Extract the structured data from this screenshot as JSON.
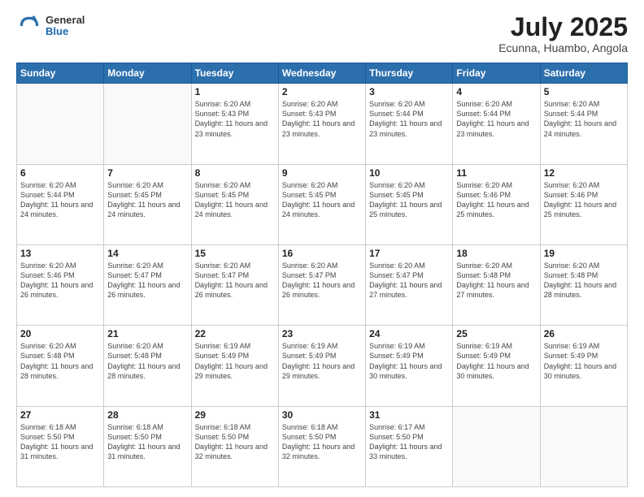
{
  "logo": {
    "general": "General",
    "blue": "Blue"
  },
  "header": {
    "month": "July 2025",
    "location": "Ecunna, Huambo, Angola"
  },
  "days_of_week": [
    "Sunday",
    "Monday",
    "Tuesday",
    "Wednesday",
    "Thursday",
    "Friday",
    "Saturday"
  ],
  "weeks": [
    [
      {
        "day": "",
        "sunrise": "",
        "sunset": "",
        "daylight": ""
      },
      {
        "day": "",
        "sunrise": "",
        "sunset": "",
        "daylight": ""
      },
      {
        "day": "1",
        "sunrise": "Sunrise: 6:20 AM",
        "sunset": "Sunset: 5:43 PM",
        "daylight": "Daylight: 11 hours and 23 minutes."
      },
      {
        "day": "2",
        "sunrise": "Sunrise: 6:20 AM",
        "sunset": "Sunset: 5:43 PM",
        "daylight": "Daylight: 11 hours and 23 minutes."
      },
      {
        "day": "3",
        "sunrise": "Sunrise: 6:20 AM",
        "sunset": "Sunset: 5:44 PM",
        "daylight": "Daylight: 11 hours and 23 minutes."
      },
      {
        "day": "4",
        "sunrise": "Sunrise: 6:20 AM",
        "sunset": "Sunset: 5:44 PM",
        "daylight": "Daylight: 11 hours and 23 minutes."
      },
      {
        "day": "5",
        "sunrise": "Sunrise: 6:20 AM",
        "sunset": "Sunset: 5:44 PM",
        "daylight": "Daylight: 11 hours and 24 minutes."
      }
    ],
    [
      {
        "day": "6",
        "sunrise": "Sunrise: 6:20 AM",
        "sunset": "Sunset: 5:44 PM",
        "daylight": "Daylight: 11 hours and 24 minutes."
      },
      {
        "day": "7",
        "sunrise": "Sunrise: 6:20 AM",
        "sunset": "Sunset: 5:45 PM",
        "daylight": "Daylight: 11 hours and 24 minutes."
      },
      {
        "day": "8",
        "sunrise": "Sunrise: 6:20 AM",
        "sunset": "Sunset: 5:45 PM",
        "daylight": "Daylight: 11 hours and 24 minutes."
      },
      {
        "day": "9",
        "sunrise": "Sunrise: 6:20 AM",
        "sunset": "Sunset: 5:45 PM",
        "daylight": "Daylight: 11 hours and 24 minutes."
      },
      {
        "day": "10",
        "sunrise": "Sunrise: 6:20 AM",
        "sunset": "Sunset: 5:45 PM",
        "daylight": "Daylight: 11 hours and 25 minutes."
      },
      {
        "day": "11",
        "sunrise": "Sunrise: 6:20 AM",
        "sunset": "Sunset: 5:46 PM",
        "daylight": "Daylight: 11 hours and 25 minutes."
      },
      {
        "day": "12",
        "sunrise": "Sunrise: 6:20 AM",
        "sunset": "Sunset: 5:46 PM",
        "daylight": "Daylight: 11 hours and 25 minutes."
      }
    ],
    [
      {
        "day": "13",
        "sunrise": "Sunrise: 6:20 AM",
        "sunset": "Sunset: 5:46 PM",
        "daylight": "Daylight: 11 hours and 26 minutes."
      },
      {
        "day": "14",
        "sunrise": "Sunrise: 6:20 AM",
        "sunset": "Sunset: 5:47 PM",
        "daylight": "Daylight: 11 hours and 26 minutes."
      },
      {
        "day": "15",
        "sunrise": "Sunrise: 6:20 AM",
        "sunset": "Sunset: 5:47 PM",
        "daylight": "Daylight: 11 hours and 26 minutes."
      },
      {
        "day": "16",
        "sunrise": "Sunrise: 6:20 AM",
        "sunset": "Sunset: 5:47 PM",
        "daylight": "Daylight: 11 hours and 26 minutes."
      },
      {
        "day": "17",
        "sunrise": "Sunrise: 6:20 AM",
        "sunset": "Sunset: 5:47 PM",
        "daylight": "Daylight: 11 hours and 27 minutes."
      },
      {
        "day": "18",
        "sunrise": "Sunrise: 6:20 AM",
        "sunset": "Sunset: 5:48 PM",
        "daylight": "Daylight: 11 hours and 27 minutes."
      },
      {
        "day": "19",
        "sunrise": "Sunrise: 6:20 AM",
        "sunset": "Sunset: 5:48 PM",
        "daylight": "Daylight: 11 hours and 28 minutes."
      }
    ],
    [
      {
        "day": "20",
        "sunrise": "Sunrise: 6:20 AM",
        "sunset": "Sunset: 5:48 PM",
        "daylight": "Daylight: 11 hours and 28 minutes."
      },
      {
        "day": "21",
        "sunrise": "Sunrise: 6:20 AM",
        "sunset": "Sunset: 5:48 PM",
        "daylight": "Daylight: 11 hours and 28 minutes."
      },
      {
        "day": "22",
        "sunrise": "Sunrise: 6:19 AM",
        "sunset": "Sunset: 5:49 PM",
        "daylight": "Daylight: 11 hours and 29 minutes."
      },
      {
        "day": "23",
        "sunrise": "Sunrise: 6:19 AM",
        "sunset": "Sunset: 5:49 PM",
        "daylight": "Daylight: 11 hours and 29 minutes."
      },
      {
        "day": "24",
        "sunrise": "Sunrise: 6:19 AM",
        "sunset": "Sunset: 5:49 PM",
        "daylight": "Daylight: 11 hours and 30 minutes."
      },
      {
        "day": "25",
        "sunrise": "Sunrise: 6:19 AM",
        "sunset": "Sunset: 5:49 PM",
        "daylight": "Daylight: 11 hours and 30 minutes."
      },
      {
        "day": "26",
        "sunrise": "Sunrise: 6:19 AM",
        "sunset": "Sunset: 5:49 PM",
        "daylight": "Daylight: 11 hours and 30 minutes."
      }
    ],
    [
      {
        "day": "27",
        "sunrise": "Sunrise: 6:18 AM",
        "sunset": "Sunset: 5:50 PM",
        "daylight": "Daylight: 11 hours and 31 minutes."
      },
      {
        "day": "28",
        "sunrise": "Sunrise: 6:18 AM",
        "sunset": "Sunset: 5:50 PM",
        "daylight": "Daylight: 11 hours and 31 minutes."
      },
      {
        "day": "29",
        "sunrise": "Sunrise: 6:18 AM",
        "sunset": "Sunset: 5:50 PM",
        "daylight": "Daylight: 11 hours and 32 minutes."
      },
      {
        "day": "30",
        "sunrise": "Sunrise: 6:18 AM",
        "sunset": "Sunset: 5:50 PM",
        "daylight": "Daylight: 11 hours and 32 minutes."
      },
      {
        "day": "31",
        "sunrise": "Sunrise: 6:17 AM",
        "sunset": "Sunset: 5:50 PM",
        "daylight": "Daylight: 11 hours and 33 minutes."
      },
      {
        "day": "",
        "sunrise": "",
        "sunset": "",
        "daylight": ""
      },
      {
        "day": "",
        "sunrise": "",
        "sunset": "",
        "daylight": ""
      }
    ]
  ]
}
